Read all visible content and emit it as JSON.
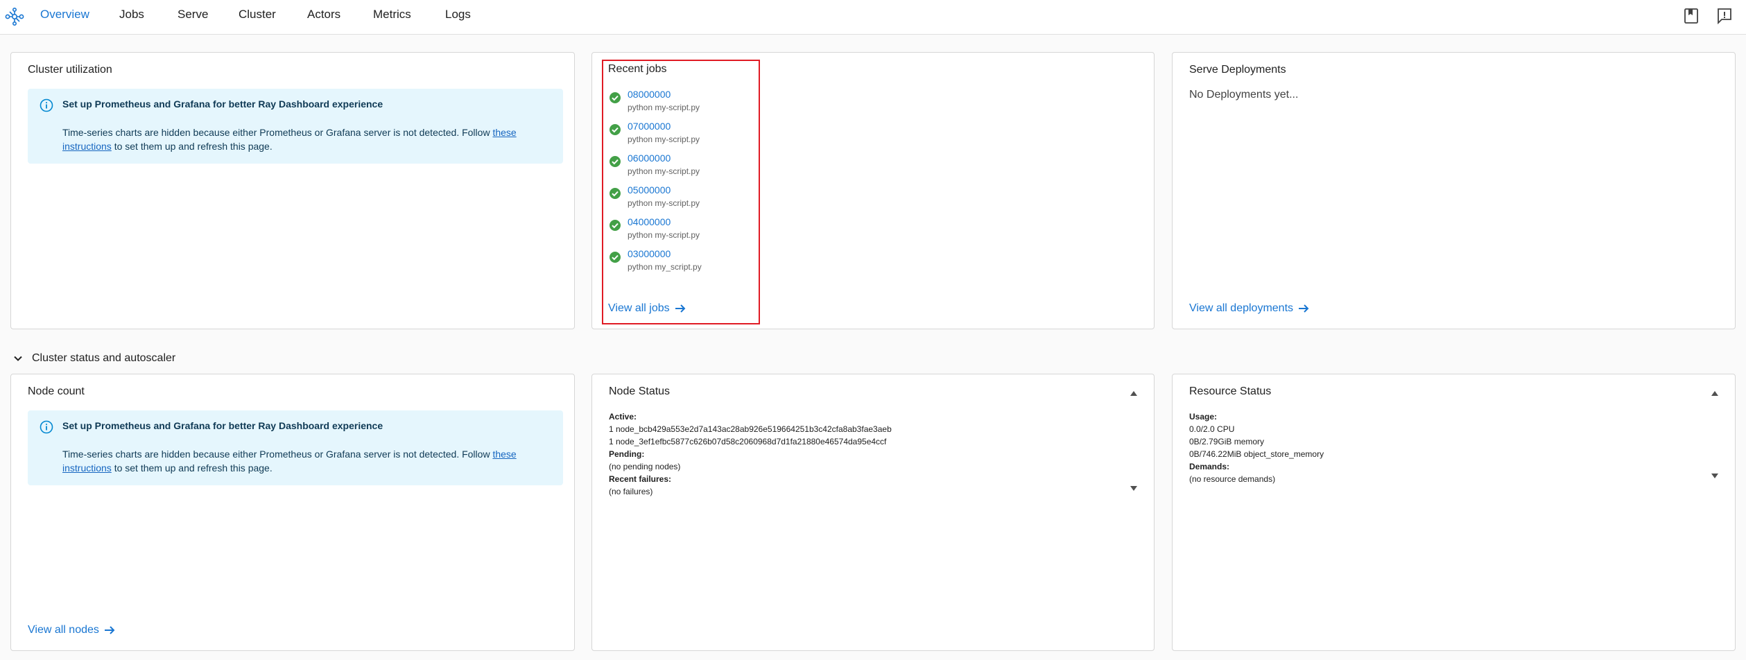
{
  "nav": {
    "items": [
      {
        "label": "Overview",
        "active": true
      },
      {
        "label": "Jobs"
      },
      {
        "label": "Serve"
      },
      {
        "label": "Cluster"
      },
      {
        "label": "Actors"
      },
      {
        "label": "Metrics"
      },
      {
        "label": "Logs"
      }
    ],
    "icons": [
      "logo-icon",
      "docs-icon",
      "feedback-icon"
    ]
  },
  "colors": {
    "accent": "#1976d2",
    "alert_bg": "#e5f6fd",
    "success": "#43a047",
    "highlight": "#e01b24"
  },
  "cluster_utilization": {
    "title": "Cluster utilization",
    "alert_title": "Set up Prometheus and Grafana for better Ray Dashboard experience",
    "alert_text_1": "Time-series charts are hidden because either Prometheus or Grafana server is not detected. Follow ",
    "alert_link_1": "these",
    "alert_link_2": "instructions",
    "alert_text_2": " to set them up and refresh this page."
  },
  "recent_jobs": {
    "title": "Recent jobs",
    "jobs": [
      {
        "id": "08000000",
        "cmd": "python my-script.py"
      },
      {
        "id": "07000000",
        "cmd": "python my-script.py"
      },
      {
        "id": "06000000",
        "cmd": "python my-script.py"
      },
      {
        "id": "05000000",
        "cmd": "python my-script.py"
      },
      {
        "id": "04000000",
        "cmd": "python my-script.py"
      },
      {
        "id": "03000000",
        "cmd": "python my_script.py"
      }
    ],
    "view_all": "View all jobs"
  },
  "serve": {
    "title": "Serve Deployments",
    "empty": "No Deployments yet...",
    "view_all": "View all deployments"
  },
  "section": {
    "title": "Cluster status and autoscaler"
  },
  "node_count": {
    "title": "Node count",
    "alert_title": "Set up Prometheus and Grafana for better Ray Dashboard experience",
    "alert_text_1": "Time-series charts are hidden because either Prometheus or Grafana server is not detected. Follow ",
    "alert_link_1": "these",
    "alert_link_2": "instructions",
    "alert_text_2": " to set them up and refresh this page.",
    "view_all": "View all nodes"
  },
  "node_status": {
    "title": "Node Status",
    "active_label": "Active:",
    "active": [
      "1 node_bcb429a553e2d7a143ac28ab926e519664251b3c42cfa8ab3fae3aeb",
      "1 node_3ef1efbc5877c626b07d58c2060968d7d1fa21880e46574da95e4ccf"
    ],
    "pending_label": "Pending:",
    "pending": "(no pending nodes)",
    "failures_label": "Recent failures:",
    "failures": "(no failures)"
  },
  "resource_status": {
    "title": "Resource Status",
    "usage_label": "Usage:",
    "usage": [
      "0.0/2.0 CPU",
      "0B/2.79GiB memory",
      "0B/746.22MiB object_store_memory"
    ],
    "demands_label": "Demands:",
    "demands": "(no resource demands)"
  }
}
